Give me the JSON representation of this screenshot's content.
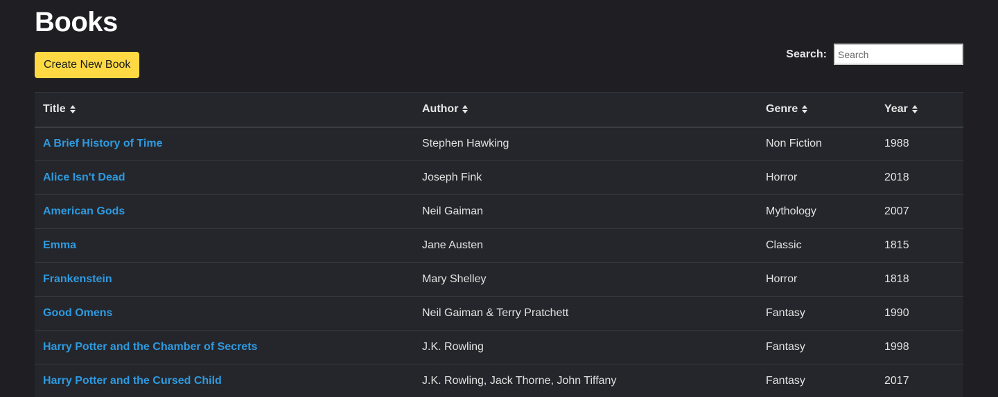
{
  "page": {
    "title": "Books",
    "create_button_label": "Create New Book"
  },
  "search": {
    "label": "Search:",
    "placeholder": "Search",
    "value": ""
  },
  "table": {
    "columns": [
      "Title",
      "Author",
      "Genre",
      "Year"
    ],
    "rows": [
      {
        "title": "A Brief History of Time",
        "author": "Stephen Hawking",
        "genre": "Non Fiction",
        "year": "1988"
      },
      {
        "title": "Alice Isn't Dead",
        "author": "Joseph Fink",
        "genre": "Horror",
        "year": "2018"
      },
      {
        "title": "American Gods",
        "author": "Neil Gaiman",
        "genre": "Mythology",
        "year": "2007"
      },
      {
        "title": "Emma",
        "author": "Jane Austen",
        "genre": "Classic",
        "year": "1815"
      },
      {
        "title": "Frankenstein",
        "author": "Mary Shelley",
        "genre": "Horror",
        "year": "1818"
      },
      {
        "title": "Good Omens",
        "author": "Neil Gaiman & Terry Pratchett",
        "genre": "Fantasy",
        "year": "1990"
      },
      {
        "title": "Harry Potter and the Chamber of Secrets",
        "author": "J.K. Rowling",
        "genre": "Fantasy",
        "year": "1998"
      },
      {
        "title": "Harry Potter and the Cursed Child",
        "author": "J.K. Rowling, Jack Thorne, John Tiffany",
        "genre": "Fantasy",
        "year": "2017"
      }
    ]
  },
  "colors": {
    "background": "#1e1e23",
    "table_background": "#24262b",
    "accent_button": "#ffd944",
    "link": "#2f9ae0"
  },
  "icons": {
    "sort": "sort-icon"
  }
}
